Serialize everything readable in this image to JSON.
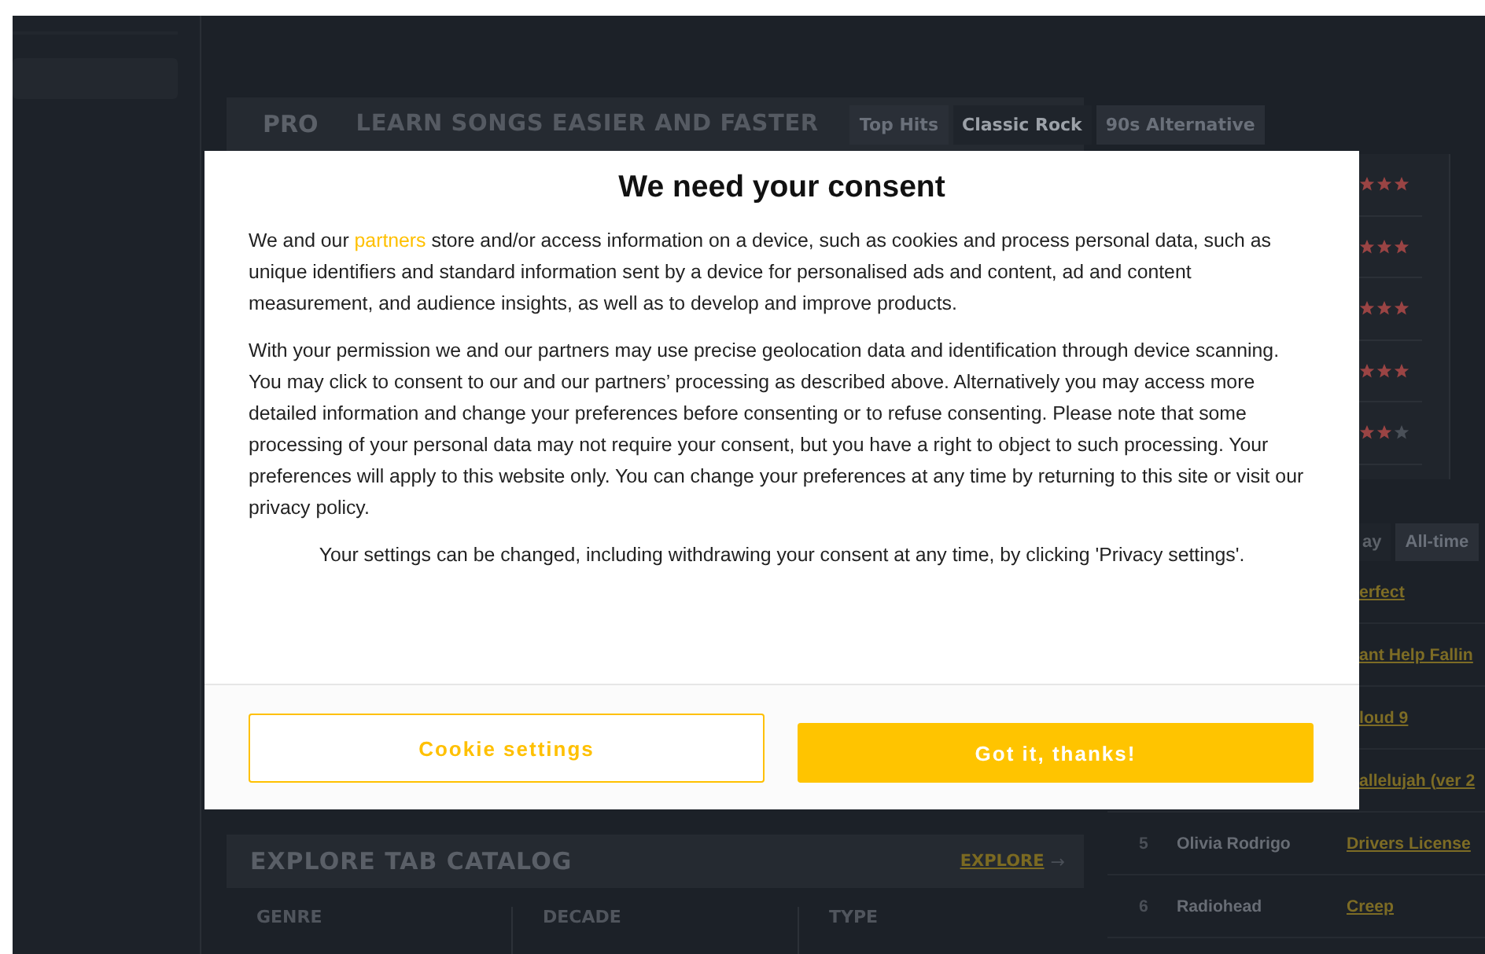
{
  "pro_panel": {
    "badge": "PRO",
    "title": "LEARN SONGS EASIER AND FASTER",
    "tabs": [
      {
        "label": "Top Hits",
        "selected": false
      },
      {
        "label": "Classic Rock",
        "selected": true
      },
      {
        "label": "90s Alternative",
        "selected": false
      }
    ]
  },
  "difficulty_rows": [
    {
      "stars": 3
    },
    {
      "stars": 3
    },
    {
      "stars": 3
    },
    {
      "stars": 3
    },
    {
      "stars": 2
    }
  ],
  "chart_tabs": [
    {
      "label": "ay",
      "selected": true
    },
    {
      "label": "All-time",
      "selected": false
    }
  ],
  "top_tabs": [
    {
      "song": "erfect"
    },
    {
      "song": "ant Help Fallin"
    },
    {
      "song": "loud 9"
    },
    {
      "song": "allelujah (ver 2"
    },
    {
      "rank": "5",
      "artist": "Olivia Rodrigo",
      "song": "Drivers License"
    },
    {
      "rank": "6",
      "artist": "Radiohead",
      "song": "Creep"
    }
  ],
  "explore": {
    "title": "EXPLORE TAB CATALOG",
    "link": "EXPLORE",
    "arrow": "→",
    "columns": [
      "GENRE",
      "DECADE",
      "TYPE"
    ]
  },
  "consent": {
    "title": "We need your consent",
    "paragraphs": [
      {
        "kind": "left",
        "before": "We and our ",
        "link": "partners",
        "after": " store and/or access information on a device, such as cookies and process personal data, such as unique identifiers and standard information sent by a device for personalised ads and content, ad and content measurement, and audience insights, as well as to develop and improve products."
      },
      {
        "kind": "left",
        "before": "With your permission we and our partners may use precise geolocation data and identification through device scanning. You may click to consent to our and our partners’ processing as described above. Alternatively you may access more detailed information and change your preferences before consenting or to refuse consenting. Please note that some processing of your personal data may not require your consent, but you have a right to object to such processing. Your preferences will apply to this website only. You can change your preferences at any time by returning to this site or visit our privacy policy."
      },
      {
        "kind": "centered",
        "before": "Your settings can be changed, including withdrawing your consent at any time, by clicking 'Privacy settings'."
      }
    ],
    "buttons": [
      {
        "label": "Cookie settings",
        "kind": "secondary"
      },
      {
        "label": "Got it, thanks!",
        "kind": "primary"
      }
    ]
  }
}
